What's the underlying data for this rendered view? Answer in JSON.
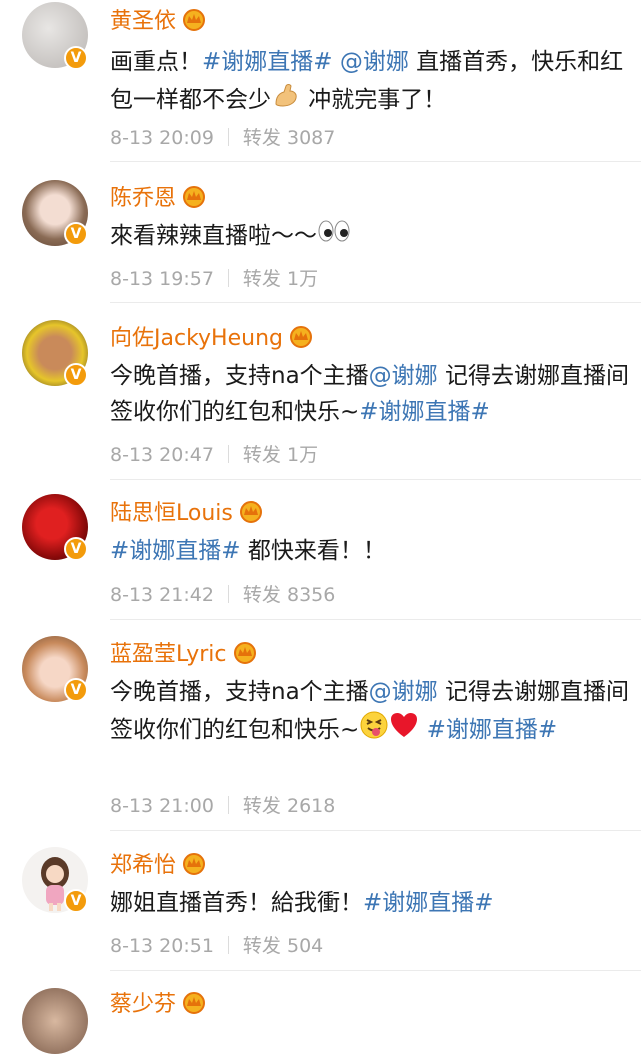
{
  "posts": [
    {
      "name": "黄圣依",
      "content": [
        {
          "t": "text",
          "v": "画重点！"
        },
        {
          "t": "tag",
          "v": "#谢娜直播#"
        },
        {
          "t": "text",
          "v": " "
        },
        {
          "t": "tag",
          "v": "@谢娜"
        },
        {
          "t": "text",
          "v": " 直播首秀，快乐和红包一样都不会少"
        },
        {
          "t": "emoji",
          "v": "muscle-emoji"
        },
        {
          "t": "text",
          "v": " 冲就完事了！"
        }
      ],
      "date": "8-13 20:09",
      "repost_label": "转发",
      "repost_count": "3087"
    },
    {
      "name": "陈乔恩",
      "content": [
        {
          "t": "text",
          "v": "來看辣辣直播啦～～"
        },
        {
          "t": "emoji",
          "v": "eyes-emoji"
        }
      ],
      "date": "8-13 19:57",
      "repost_label": "转发",
      "repost_count": "1万"
    },
    {
      "name": "向佐JackyHeung",
      "content": [
        {
          "t": "text",
          "v": "今晚首播，支持na个主播"
        },
        {
          "t": "tag",
          "v": "@谢娜"
        },
        {
          "t": "text",
          "v": " 记得去谢娜直播间签收你们的红包和快乐~"
        },
        {
          "t": "tag",
          "v": "#谢娜直播#"
        }
      ],
      "date": "8-13 20:47",
      "repost_label": "转发",
      "repost_count": "1万"
    },
    {
      "name": "陆思恒Louis",
      "content": [
        {
          "t": "tag",
          "v": "#谢娜直播#"
        },
        {
          "t": "text",
          "v": " 都快来看！！"
        }
      ],
      "date": "8-13 21:42",
      "repost_label": "转发",
      "repost_count": "8356"
    },
    {
      "name": "蓝盈莹Lyric",
      "content": [
        {
          "t": "text",
          "v": "今晚首播，支持na个主播"
        },
        {
          "t": "tag",
          "v": "@谢娜"
        },
        {
          "t": "text",
          "v": " 记得去谢娜直播间签收你们的红包和快乐~"
        },
        {
          "t": "emoji",
          "v": "tongue-emoji"
        },
        {
          "t": "emoji",
          "v": "heart-emoji"
        },
        {
          "t": "text",
          "v": " "
        },
        {
          "t": "tag",
          "v": "#谢娜直播#"
        }
      ],
      "date": "8-13 21:00",
      "repost_label": "转发",
      "repost_count": "2618"
    },
    {
      "name": "郑希怡",
      "content": [
        {
          "t": "text",
          "v": "娜姐直播首秀！給我衝！"
        },
        {
          "t": "tag",
          "v": "#谢娜直播#"
        }
      ],
      "date": "8-13 20:51",
      "repost_label": "转发",
      "repost_count": "504"
    },
    {
      "name": "蔡少芬",
      "content": [],
      "date": "",
      "repost_label": "",
      "repost_count": ""
    }
  ],
  "colors": {
    "name": "#e8720a",
    "tag": "#3d76b4",
    "meta": "#a8a8a8",
    "badge": "#f39b0b"
  },
  "icons": {
    "verified": "verified-v-badge",
    "vip": "crown-icon"
  }
}
